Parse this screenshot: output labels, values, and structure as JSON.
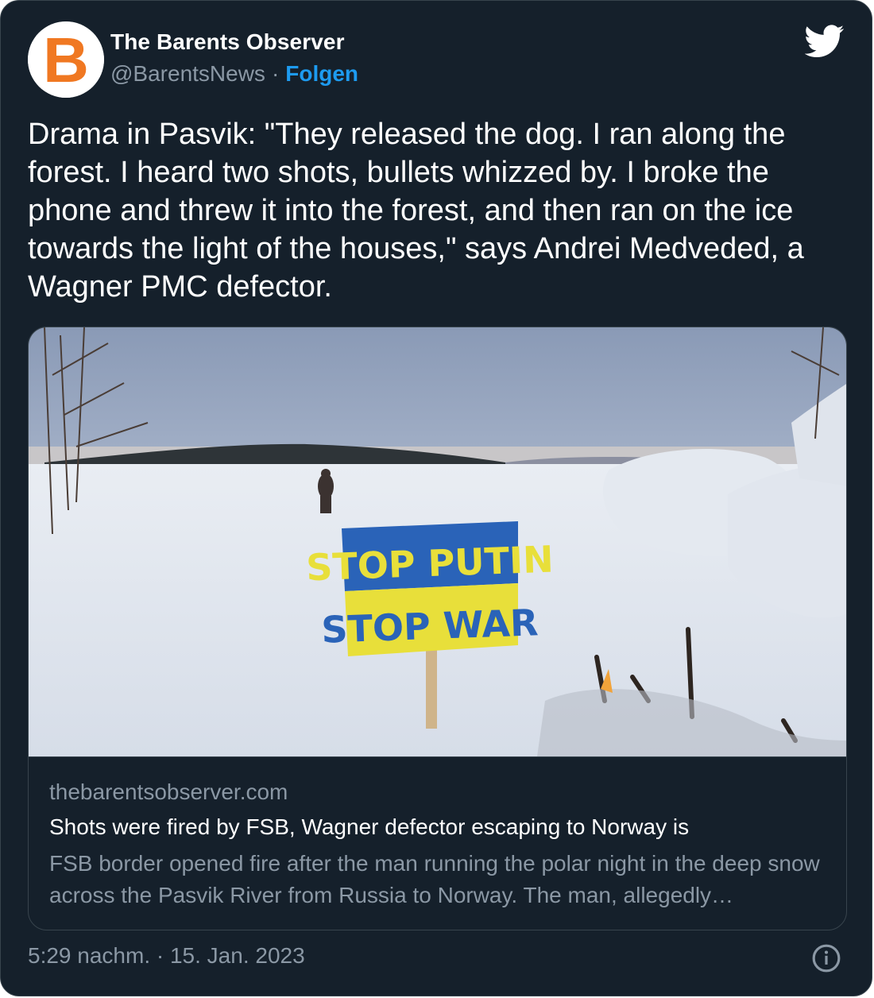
{
  "author": {
    "display_name": "The Barents Observer",
    "handle": "@BarentsNews",
    "separator": "·",
    "follow_label": "Folgen",
    "avatar_letter": "B"
  },
  "tweet": {
    "text": "Drama in Pasvik: \"They released the dog. I ran along the forest. I heard two shots, bullets whizzed by. I broke the phone and threw it into the forest, and then ran on the ice towards the light of the houses,\" says Andrei Medveded, a Wagner PMC defector."
  },
  "card": {
    "image_alt": "snowy riverbank with sign",
    "sign_line1": "STOP PUTIN",
    "sign_line2": "STOP WAR",
    "domain": "thebarentsobserver.com",
    "title": "Shots were fired by FSB, Wagner defector escaping to Norway is",
    "description": "FSB border opened fire after the man running the polar night in the deep snow across the Pasvik River from Russia to Norway. The man, allegedly…"
  },
  "timestamp": "5:29 nachm. · 15. Jan. 2023",
  "icons": {
    "brand": "twitter-bird-icon",
    "info": "info-icon"
  },
  "colors": {
    "background": "#15202b",
    "accent": "#1d9bf0",
    "brand_orange": "#f07822",
    "sign_blue": "#2a63b8",
    "sign_yellow": "#e8df3a"
  }
}
